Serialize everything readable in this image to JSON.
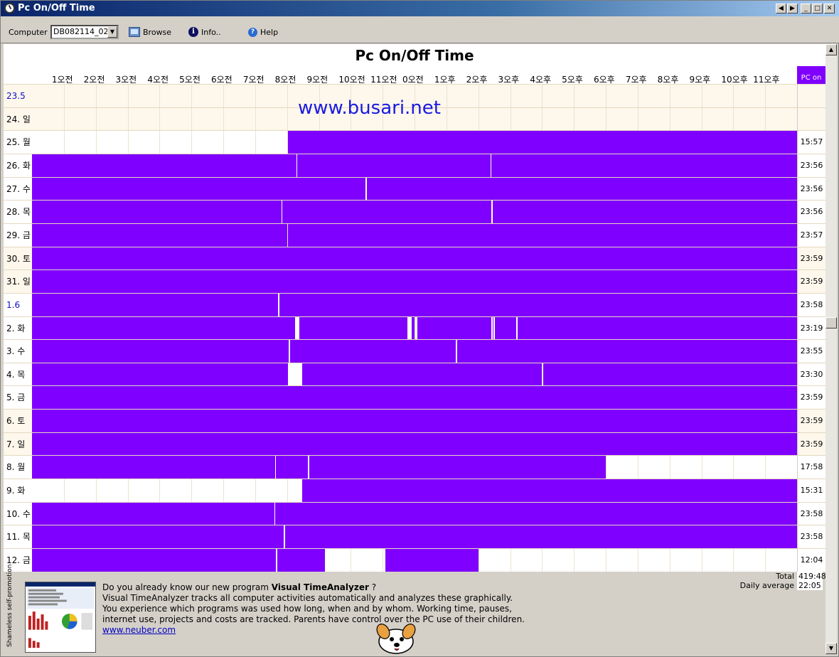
{
  "window": {
    "title": "Pc On/Off Time"
  },
  "toolbar": {
    "computer_label": "Computer",
    "computer_value": "DB082114_02",
    "browse_label": "Browse",
    "info_label": "Info..",
    "help_label": "Help"
  },
  "chart_data": {
    "type": "table",
    "title": "Pc On/Off Time",
    "hour_labels": [
      "1오전",
      "2오전",
      "3오전",
      "4오전",
      "5오전",
      "6오전",
      "7오전",
      "8오전",
      "9오전",
      "10오전",
      "11오전",
      "0오전",
      "1오후",
      "2오후",
      "3오후",
      "4오후",
      "5오후",
      "6오후",
      "7오후",
      "8오후",
      "9오후",
      "10오후",
      "11오후"
    ],
    "pc_on_header": "PC on",
    "rows": [
      {
        "label": "23.5",
        "total": "",
        "blue": true,
        "weekend": true,
        "segments": []
      },
      {
        "label": "24. 일",
        "total": "",
        "blue": false,
        "weekend": true,
        "segments": []
      },
      {
        "label": "25. 월",
        "total": "15:57",
        "segments": [
          [
            8.03,
            24.0
          ]
        ]
      },
      {
        "label": "26. 화",
        "total": "23:56",
        "segments": [
          [
            0,
            8.3
          ],
          [
            8.33,
            14.38
          ],
          [
            14.41,
            24.0
          ]
        ]
      },
      {
        "label": "27. 수",
        "total": "23:56",
        "segments": [
          [
            0,
            10.46
          ],
          [
            10.5,
            24.0
          ]
        ]
      },
      {
        "label": "28. 목",
        "total": "23:56",
        "segments": [
          [
            0,
            7.83
          ],
          [
            7.86,
            14.42
          ],
          [
            14.45,
            24.0
          ]
        ]
      },
      {
        "label": "29. 금",
        "total": "23:57",
        "segments": [
          [
            0,
            8.0
          ],
          [
            8.03,
            24.0
          ]
        ]
      },
      {
        "label": "30. 토",
        "total": "23:59",
        "weekend": true,
        "segments": [
          [
            0,
            24.0
          ]
        ]
      },
      {
        "label": "31. 일",
        "total": "23:59",
        "weekend": true,
        "segments": [
          [
            0,
            24.0
          ]
        ]
      },
      {
        "label": "1.6",
        "total": "23:58",
        "blue": true,
        "segments": [
          [
            0,
            7.72
          ],
          [
            7.76,
            24.0
          ]
        ]
      },
      {
        "label": "2. 화",
        "total": "23:19",
        "segments": [
          [
            0,
            8.26
          ],
          [
            8.38,
            11.77
          ],
          [
            11.92,
            12.0
          ],
          [
            12.08,
            14.4
          ],
          [
            14.45,
            14.47
          ],
          [
            14.52,
            15.2
          ],
          [
            15.23,
            24.0
          ]
        ]
      },
      {
        "label": "3. 수",
        "total": "23:55",
        "segments": [
          [
            0,
            8.06
          ],
          [
            8.1,
            13.3
          ],
          [
            13.33,
            24.0
          ]
        ]
      },
      {
        "label": "4. 목",
        "total": "23:30",
        "segments": [
          [
            0,
            8.03
          ],
          [
            8.47,
            16.0
          ],
          [
            16.03,
            24.0
          ]
        ]
      },
      {
        "label": "5. 금",
        "total": "23:59",
        "segments": [
          [
            0,
            24.0
          ]
        ]
      },
      {
        "label": "6. 토",
        "total": "23:59",
        "weekend": true,
        "segments": [
          [
            0,
            24.0
          ]
        ]
      },
      {
        "label": "7. 일",
        "total": "23:59",
        "weekend": true,
        "segments": [
          [
            0,
            24.0
          ]
        ]
      },
      {
        "label": "8. 월",
        "total": "17:58",
        "segments": [
          [
            0,
            7.63
          ],
          [
            7.66,
            8.66
          ],
          [
            8.7,
            18.0
          ]
        ]
      },
      {
        "label": "9. 화",
        "total": "15:31",
        "segments": [
          [
            8.47,
            24.0
          ]
        ]
      },
      {
        "label": "10. 수",
        "total": "23:58",
        "segments": [
          [
            0,
            7.6
          ],
          [
            7.63,
            24.0
          ]
        ]
      },
      {
        "label": "11. 목",
        "total": "23:58",
        "segments": [
          [
            0,
            7.9
          ],
          [
            7.93,
            24.0
          ]
        ]
      },
      {
        "label": "12. 금",
        "total": "12:04",
        "segments": [
          [
            0,
            7.66
          ],
          [
            7.69,
            9.2
          ],
          [
            11.08,
            14.0
          ]
        ]
      }
    ]
  },
  "watermark": "www.busari.net",
  "totals": {
    "total_label": "Total",
    "total_value": "419:48",
    "avg_label": "Daily average",
    "avg_value": "22:05"
  },
  "promo": {
    "vertical_label": "Shameless self-promotion",
    "line1_prefix": "Do you already know our new program ",
    "line1_bold": "Visual TimeAnalyzer",
    "line1_suffix": " ?",
    "line2": "Visual TimeAnalyzer tracks all computer activities automatically and analyzes these graphically.",
    "line3": "You experience which programs was used how long, when and by whom. Working time, pauses,",
    "line4": "internet use, projects and costs are tracked. Parents have control over the PC use of their children.",
    "link": "www.neuber.com"
  },
  "colors": {
    "on": "#8000ff",
    "title_bar": "#0a246a"
  }
}
